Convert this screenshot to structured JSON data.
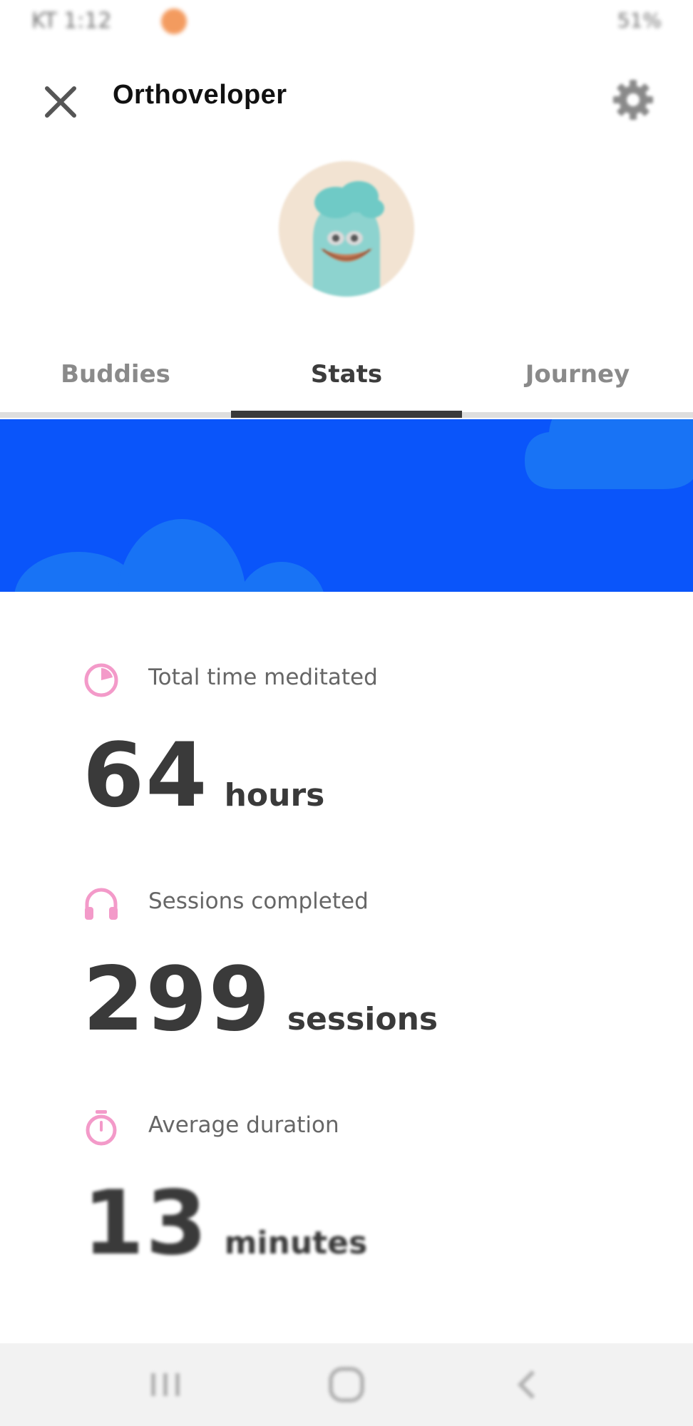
{
  "status_bar": {
    "time": "KT 1:12",
    "right_text": "51%"
  },
  "header": {
    "close_icon": "close-icon",
    "title": "Orthoveloper",
    "settings_icon": "gear-icon"
  },
  "avatar": {
    "icon": "avatar-character-icon"
  },
  "tabs": [
    {
      "label": "Buddies",
      "active": false
    },
    {
      "label": "Stats",
      "active": true
    },
    {
      "label": "Journey",
      "active": false
    }
  ],
  "stats": [
    {
      "icon": "pie-clock-icon",
      "label": "Total time meditated",
      "value": "64",
      "unit": "hours"
    },
    {
      "icon": "headphones-icon",
      "label": "Sessions completed",
      "value": "299",
      "unit": "sessions"
    },
    {
      "icon": "stopwatch-icon",
      "label": "Average duration",
      "value": "13",
      "unit": "minutes"
    }
  ],
  "nav_bar": {
    "recents_icon": "recents-icon",
    "home_icon": "home-icon",
    "back_icon": "back-icon"
  },
  "colors": {
    "banner_blue": "#0a55fa",
    "cloud_blue": "#1873f5",
    "stat_icon_pink": "#f39ac9",
    "tab_indicator": "#3a3a3a"
  }
}
